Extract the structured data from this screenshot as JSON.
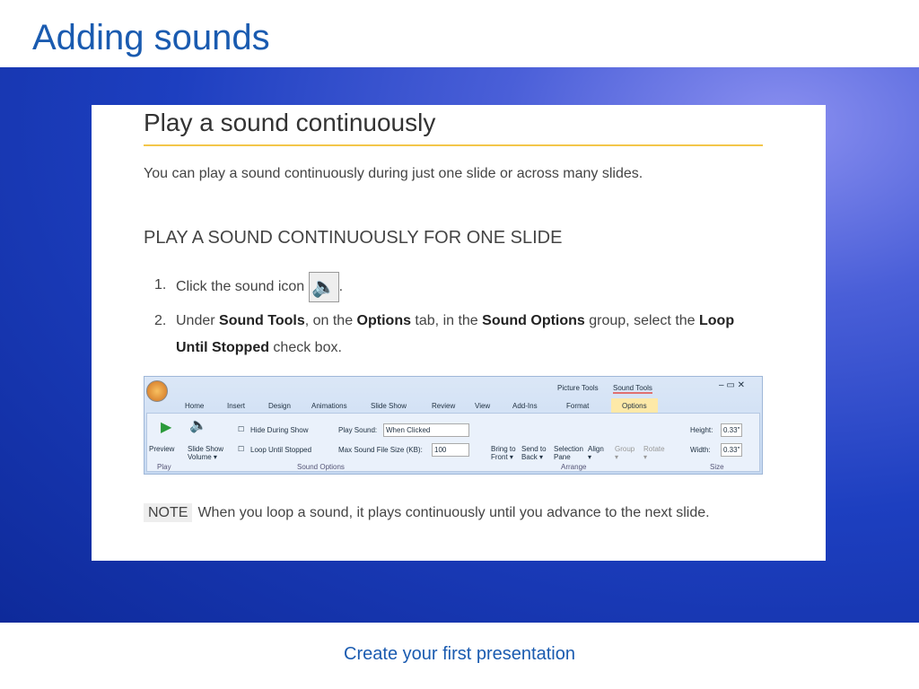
{
  "title": "Adding sounds",
  "heading": "Play a sound continuously",
  "intro": "You can play a sound continuously during just one slide or across many slides.",
  "subheading": "PLAY A SOUND CONTINUOUSLY FOR ONE SLIDE",
  "steps": [
    {
      "num": "1.",
      "text": "Click the sound icon",
      "end": "."
    },
    {
      "num": "2.",
      "pre": "Under ",
      "b1": "Sound Tools",
      ",": "",
      "m1": ", on the ",
      "b2": "Options",
      "m2": " tab, in the ",
      "b3": "Sound Options",
      "m3": " group, select the ",
      "b4": "Loop Until Stopped",
      "m4": " check box."
    }
  ],
  "ribbon": {
    "tabs": [
      "Home",
      "Insert",
      "Design",
      "Animations",
      "Slide Show",
      "Review",
      "View",
      "Add-Ins",
      "Format",
      "Options"
    ],
    "context": [
      "Picture Tools",
      "Sound Tools"
    ],
    "preview": "Preview",
    "volume": "Slide Show Volume ▾",
    "hide": "Hide During Show",
    "loop": "Loop Until Stopped",
    "play_sound": "Play Sound:",
    "play_value": "When Clicked",
    "max_size": "Max Sound File Size (KB):",
    "max_value": "100",
    "arrange": [
      "Bring to Front ▾",
      "Send to Back ▾",
      "Selection Pane",
      "Align ▾",
      "Group ▾",
      "Rotate ▾"
    ],
    "height": "Height:",
    "height_value": "0.33\"",
    "width": "Width:",
    "width_value": "0.33\"",
    "groups": [
      "Play",
      "Sound Options",
      "Arrange",
      "Size"
    ]
  },
  "note_label": "NOTE",
  "note": "When you loop a sound, it plays continuously until you advance to the next slide.",
  "footer": "Create your first presentation"
}
